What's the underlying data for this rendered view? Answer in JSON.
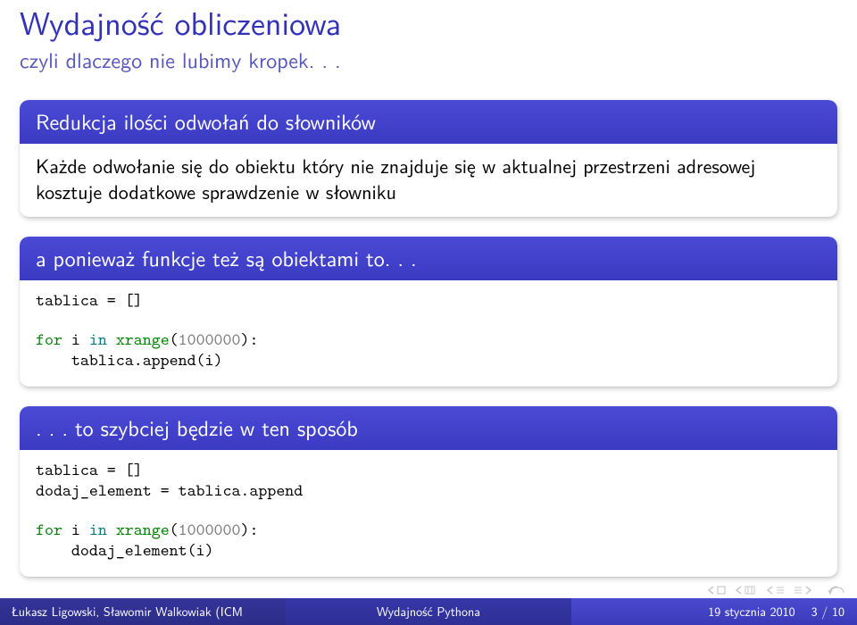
{
  "title": "Wydajność obliczeniowa",
  "subtitle": "czyli dlaczego nie lubimy kropek. . .",
  "block1": {
    "title": "Redukcja ilości odwołań do słowników",
    "body": "Każde odwołanie się do obiektu który nie znajduje się w aktualnej przestrzeni adresowej kosztuje dodatkowe sprawdzenie w słowniku"
  },
  "block2": {
    "title": "a ponieważ funkcje też są obiektami to. . .",
    "code": {
      "l1a": "tablica = []",
      "l2a": "for",
      "l2b": " i ",
      "l2c": "in",
      "l2d": " ",
      "l2e": "xrange",
      "l2f": "(",
      "l2g": "1000000",
      "l2h": "):",
      "l3": "    tablica.append(i)"
    }
  },
  "block3": {
    "title": ". . . to szybciej będzie w ten sposób",
    "code": {
      "l1": "tablica = []",
      "l2": "dodaj_element = tablica.append",
      "l3a": "for",
      "l3b": " i ",
      "l3c": "in",
      "l3d": " ",
      "l3e": "xrange",
      "l3f": "(",
      "l3g": "1000000",
      "l3h": "):",
      "l4": "    dodaj_element(i)"
    }
  },
  "footer": {
    "author": "Łukasz Ligowski, Sławomir Walkowiak (ICM",
    "short_title": "Wydajność Pythona",
    "date": "19 stycznia 2010",
    "page": "3 / 10"
  }
}
